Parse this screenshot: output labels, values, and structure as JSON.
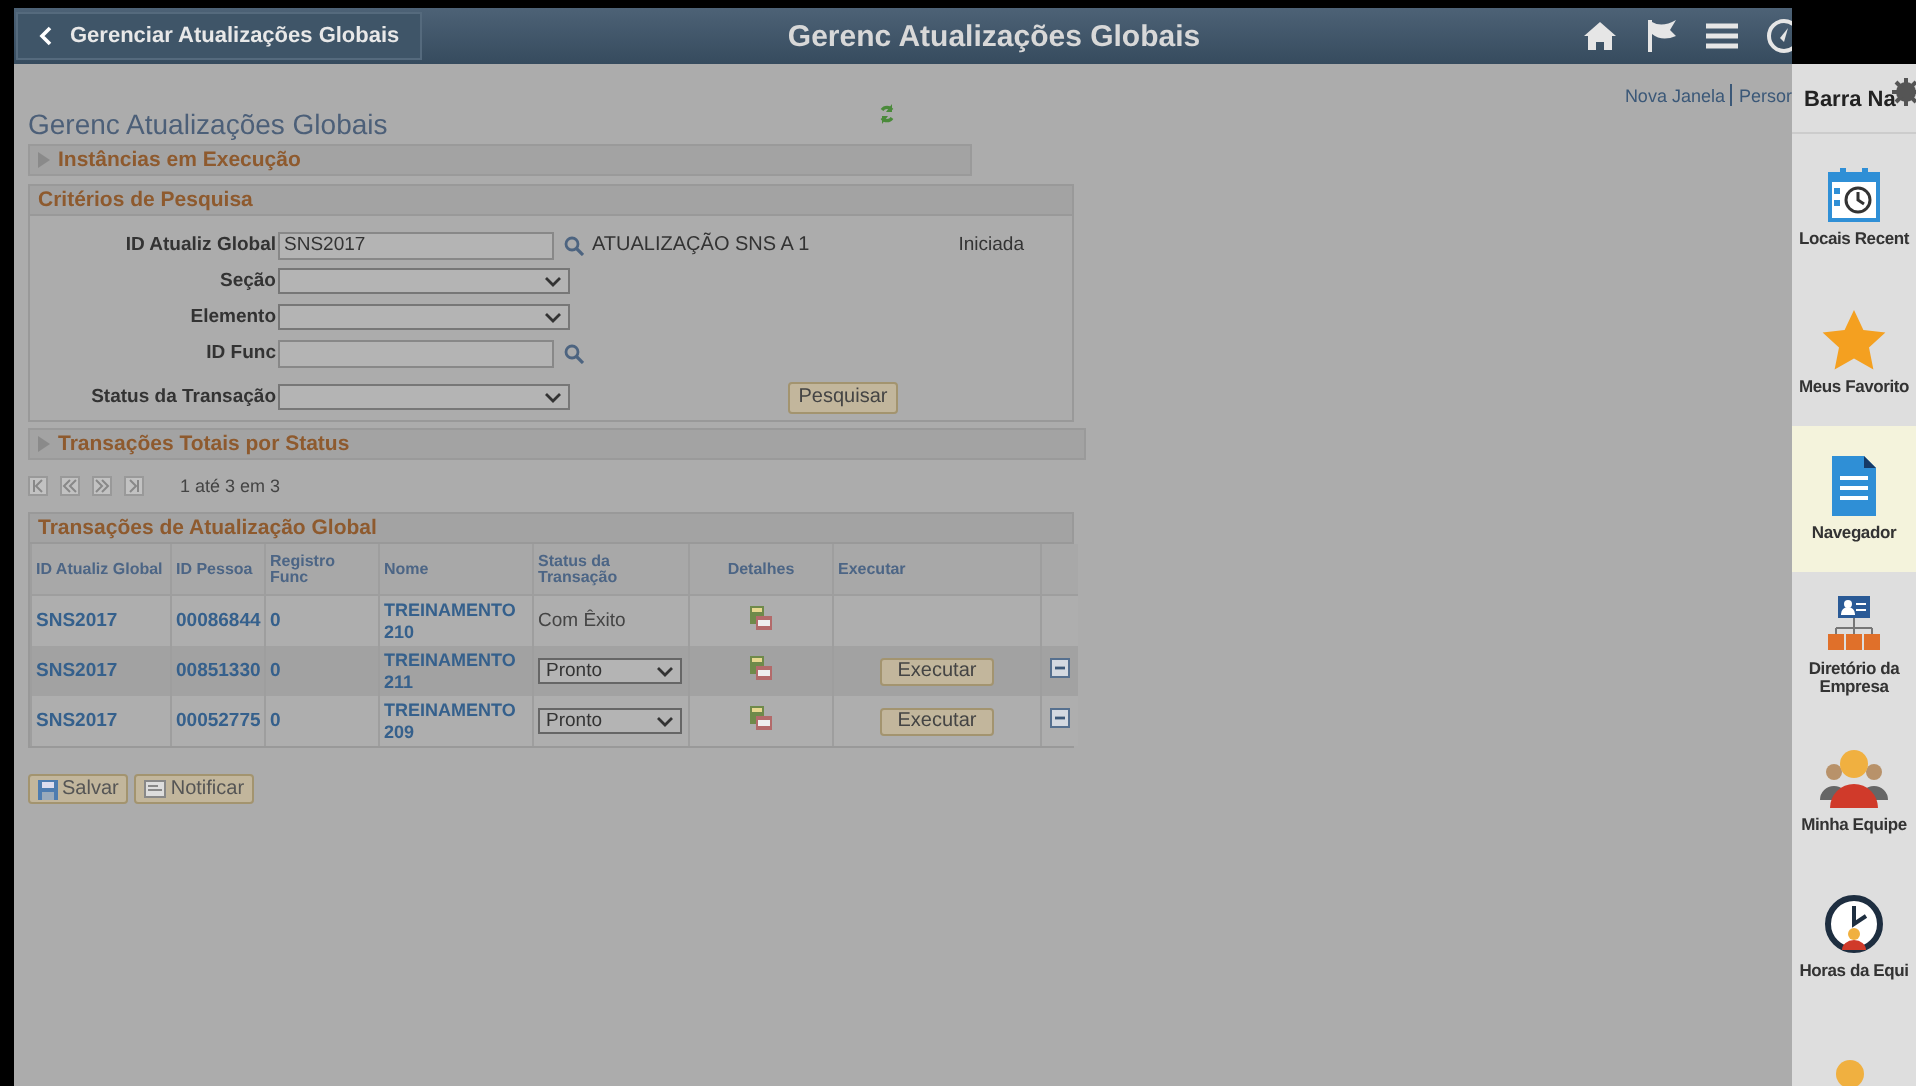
{
  "header": {
    "back_label": "Gerenciar Atualizações Globais",
    "title": "Gerenc Atualizações Globais"
  },
  "top_links": [
    "Nova Janela",
    "Persor"
  ],
  "page_title": "Gerenc Atualizações Globais",
  "running_section": {
    "label": "Instâncias em Execução",
    "expanded": false
  },
  "search": {
    "title": "Critérios de Pesquisa",
    "fields": [
      {
        "kind": "lookup",
        "label": "ID Atualiz Global",
        "value": "SNS2017",
        "description": "ATUALIZAÇÃO SNS A 1",
        "status": "Iniciada"
      },
      {
        "kind": "select",
        "label": "Seção"
      },
      {
        "kind": "select",
        "label": "Elemento"
      },
      {
        "kind": "lookup",
        "label": "ID Func"
      },
      {
        "kind": "select",
        "label": "Status da Transação"
      }
    ],
    "button": "Pesquisar"
  },
  "totals_section": {
    "label": "Transações Totais por Status",
    "expanded": false
  },
  "pagination": {
    "text": "1 até 3 em 3"
  },
  "grid": {
    "title": "Transações de Atualização Global",
    "columns": [
      "ID Atualiz Global",
      "ID Pessoa",
      "Registro Func",
      "Nome",
      "Status da Transação",
      "Detalhes",
      "Executar"
    ],
    "rows": [
      {
        "global_id": "SNS2017",
        "person_id": "00086844",
        "record": "0",
        "name": "TREINAMENTO 210",
        "status": {
          "kind": "text",
          "text": "Com Êxito"
        }
      },
      {
        "global_id": "SNS2017",
        "person_id": "00851330",
        "record": "0",
        "name": "TREINAMENTO 211",
        "status": {
          "kind": "select",
          "text": "Pronto"
        },
        "run_button": "Executar"
      },
      {
        "global_id": "SNS2017",
        "person_id": "00052775",
        "record": "0",
        "name": "TREINAMENTO 209",
        "status": {
          "kind": "select",
          "text": "Pronto"
        },
        "run_button": "Executar"
      }
    ]
  },
  "buttons": [
    "Salvar",
    "Notificar"
  ],
  "nav_bar": {
    "title": "Barra Na",
    "items": [
      {
        "label": "Locais Recent",
        "selected": false
      },
      {
        "label": "Meus Favorito",
        "selected": false
      },
      {
        "label": "Navegador",
        "selected": true
      },
      {
        "label": "Diretório da Empresa",
        "selected": false
      },
      {
        "label": "Minha Equipe",
        "selected": false
      },
      {
        "label": "Horas da Equi",
        "selected": false
      },
      {
        "selected": false
      }
    ]
  }
}
